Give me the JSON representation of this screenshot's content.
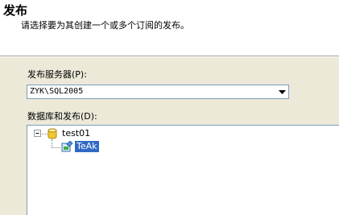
{
  "header": {
    "title": "发布",
    "subtitle": "请选择要为其创建一个或多个订阅的发布。"
  },
  "server": {
    "label": "发布服务器(P):",
    "value": "ZYK\\SQL2005"
  },
  "tree": {
    "label": "数据库和发布(D):",
    "items": [
      {
        "label": "test01",
        "icon": "database-icon",
        "expanded": true
      },
      {
        "label": "TeAk",
        "icon": "publication-icon",
        "selected": true
      }
    ]
  },
  "colors": {
    "selection": "#316ac5",
    "panel": "#ece9d8",
    "border": "#7f9db9"
  }
}
